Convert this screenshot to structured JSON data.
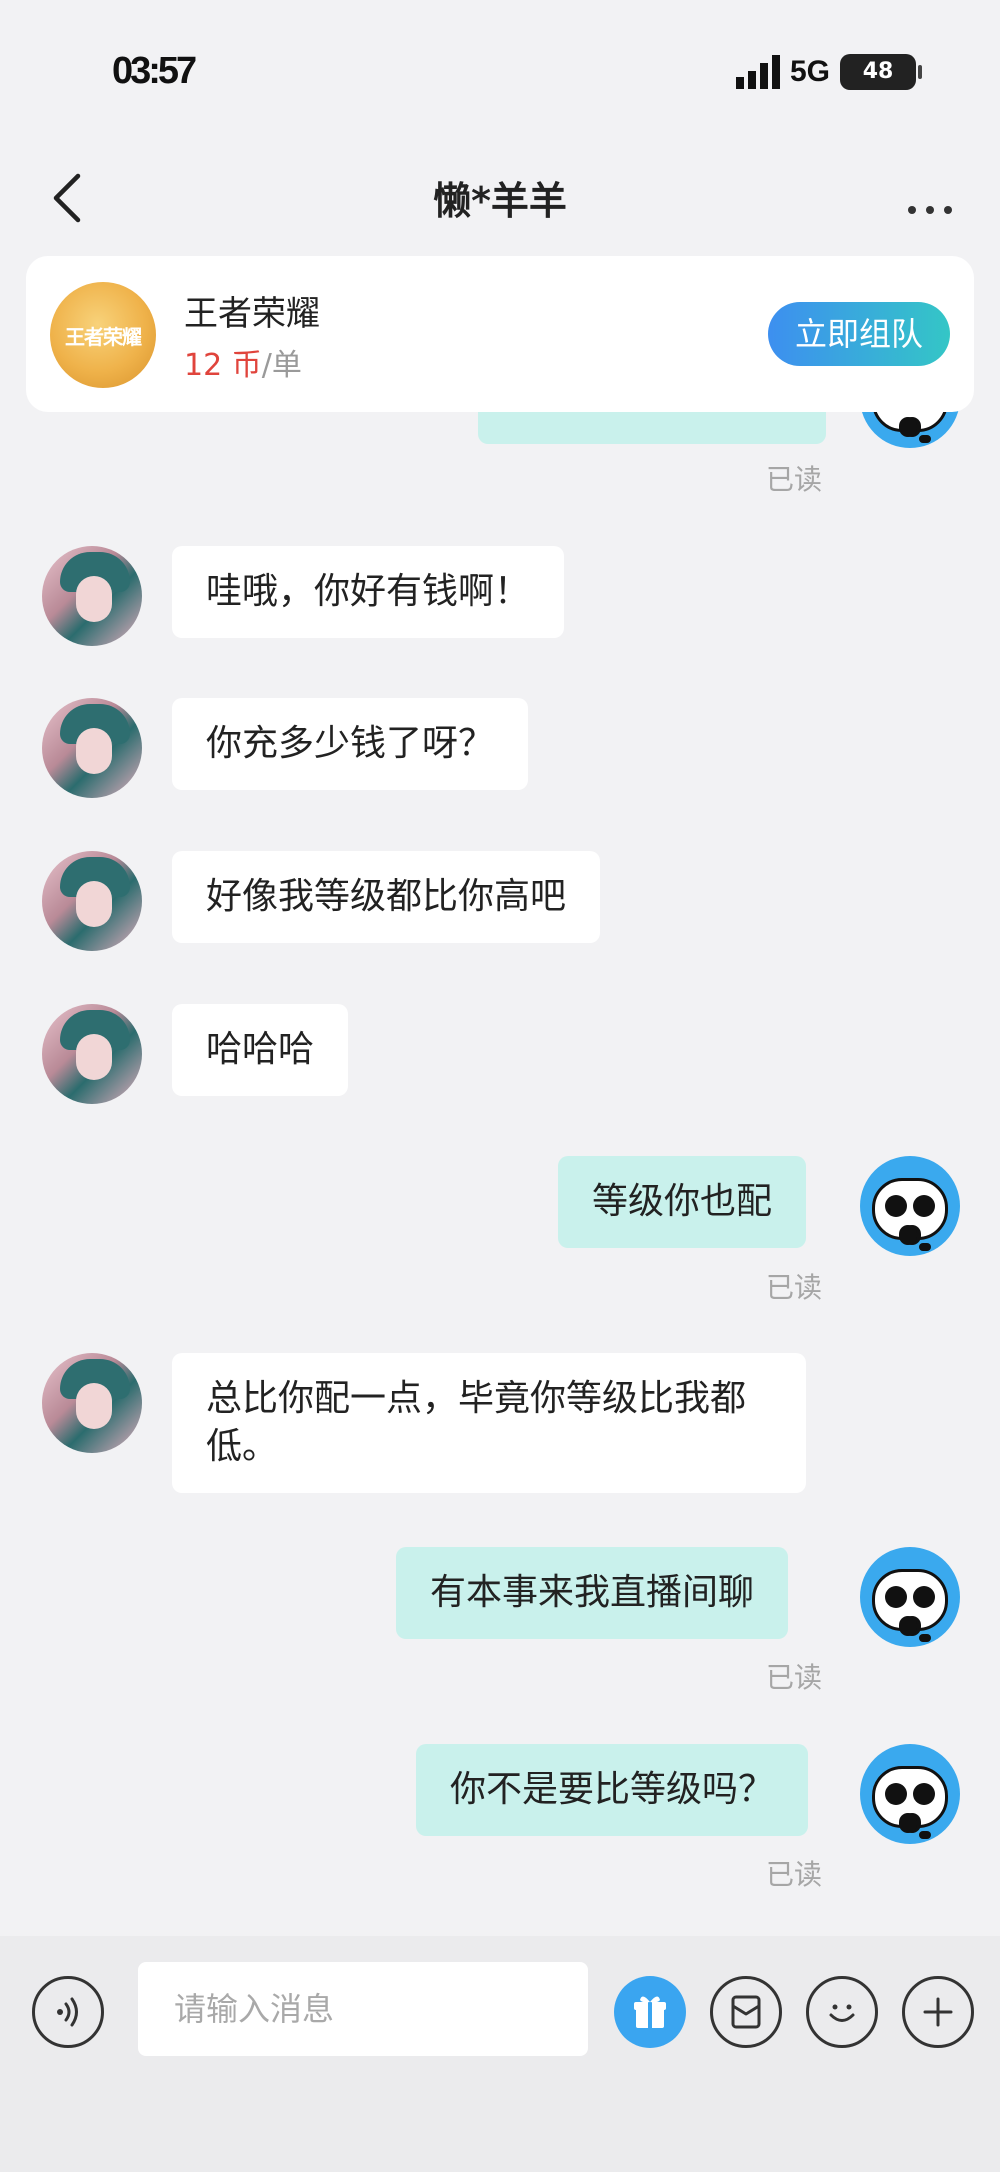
{
  "status_bar": {
    "time": "03:57",
    "network": "5G",
    "battery": "48"
  },
  "header": {
    "title": "懒*羊羊"
  },
  "game_card": {
    "logo_text": "王者荣耀",
    "name": "王者荣耀",
    "price_value": "12 币",
    "price_unit": "/单",
    "team_button": "立即组队"
  },
  "messages": [
    {
      "sender": "me",
      "text": "",
      "read": "已读"
    },
    {
      "sender": "other",
      "text": "哇哦，你好有钱啊！"
    },
    {
      "sender": "other",
      "text": "你充多少钱了呀？"
    },
    {
      "sender": "other",
      "text": "好像我等级都比你高吧"
    },
    {
      "sender": "other",
      "text": "哈哈哈"
    },
    {
      "sender": "me",
      "text": "等级你也配",
      "read": "已读"
    },
    {
      "sender": "other",
      "text": "总比你配一点，毕竟你等级比我都低。"
    },
    {
      "sender": "me",
      "text": "有本事来我直播间聊",
      "read": "已读"
    },
    {
      "sender": "me",
      "text": "你不是要比等级吗？",
      "read": "已读"
    }
  ],
  "input": {
    "placeholder": "请输入消息"
  },
  "icons": {
    "back": "chevron-left-icon",
    "more": "more-dots-icon",
    "voice": "voice-icon",
    "gift": "gift-icon",
    "coupon": "coupon-icon",
    "emoji": "emoji-icon",
    "plus": "plus-icon"
  },
  "colors": {
    "accent_blue": "#3aa5f0",
    "my_bubble": "#c9f1ec",
    "price_red": "#e0443c"
  }
}
